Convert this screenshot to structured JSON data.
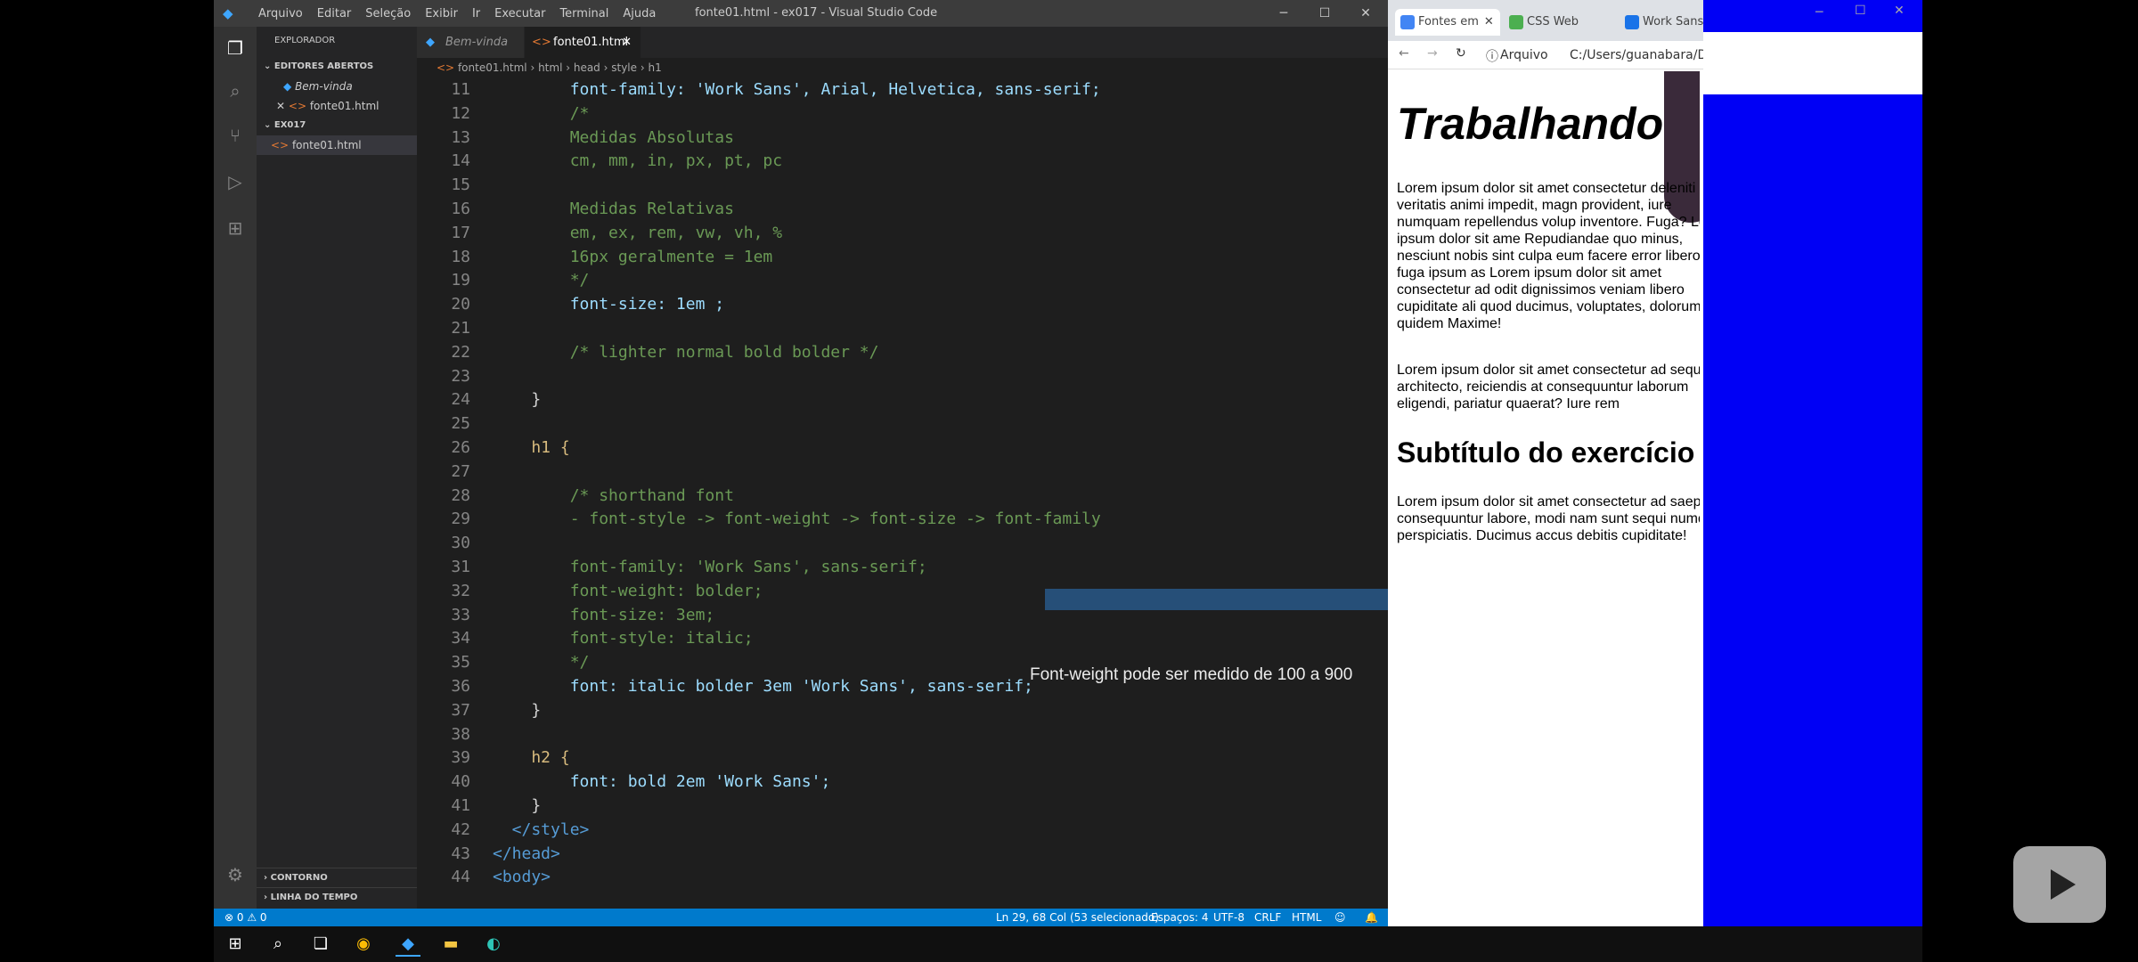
{
  "window": {
    "title": "fonte01.html - ex017 - Visual Studio Code",
    "menu": [
      "Arquivo",
      "Editar",
      "Seleção",
      "Exibir",
      "Ir",
      "Executar",
      "Terminal",
      "Ajuda"
    ]
  },
  "sidebar": {
    "title": "EXPLORADOR",
    "open_editors_header": "EDITORES ABERTOS",
    "open_editors": [
      "Bem-vinda",
      "fonte01.html"
    ],
    "folder_header": "EX017",
    "folder_files": [
      "fonte01.html"
    ],
    "outline": "CONTORNO",
    "timeline": "LINHA DO TEMPO"
  },
  "tabs": [
    "Bem-vinda",
    "fonte01.html"
  ],
  "breadcrumb": [
    "fonte01.html",
    "html",
    "head",
    "style",
    "h1"
  ],
  "code": {
    "lines": [
      {
        "n": "11",
        "text": "        font-family: 'Work Sans', Arial, Helvetica, sans-serif;"
      },
      {
        "n": "12",
        "text": "        /*"
      },
      {
        "n": "13",
        "text": "        Medidas Absolutas"
      },
      {
        "n": "14",
        "text": "        cm, mm, in, px, pt, pc"
      },
      {
        "n": "15",
        "text": ""
      },
      {
        "n": "16",
        "text": "        Medidas Relativas"
      },
      {
        "n": "17",
        "text": "        em, ex, rem, vw, vh, %"
      },
      {
        "n": "18",
        "text": "        16px geralmente = 1em"
      },
      {
        "n": "19",
        "text": "        */"
      },
      {
        "n": "20",
        "text": "        font-size: 1em ;"
      },
      {
        "n": "21",
        "text": ""
      },
      {
        "n": "22",
        "text": "        /* lighter normal bold bolder */"
      },
      {
        "n": "23",
        "text": ""
      },
      {
        "n": "24",
        "text": "    }"
      },
      {
        "n": "25",
        "text": ""
      },
      {
        "n": "26",
        "text": "    h1 {"
      },
      {
        "n": "27",
        "text": ""
      },
      {
        "n": "28",
        "text": "        /* shorthand font"
      },
      {
        "n": "29",
        "text": "        - font-style -> font-weight -> font-size -> font-family"
      },
      {
        "n": "30",
        "text": ""
      },
      {
        "n": "31",
        "text": "        font-family: 'Work Sans', sans-serif;"
      },
      {
        "n": "32",
        "text": "        font-weight: bolder;"
      },
      {
        "n": "33",
        "text": "        font-size: 3em;"
      },
      {
        "n": "34",
        "text": "        font-style: italic;"
      },
      {
        "n": "35",
        "text": "        */"
      },
      {
        "n": "36",
        "text": "        font: italic bolder 3em 'Work Sans', sans-serif;"
      },
      {
        "n": "37",
        "text": "    }"
      },
      {
        "n": "38",
        "text": ""
      },
      {
        "n": "39",
        "text": "    h2 {"
      },
      {
        "n": "40",
        "text": "        font: bold 2em 'Work Sans';"
      },
      {
        "n": "41",
        "text": "    }"
      },
      {
        "n": "42",
        "text": "  </style>"
      },
      {
        "n": "43",
        "text": "</head>"
      },
      {
        "n": "44",
        "text": "<body>"
      }
    ],
    "tooltip": "Font-weight pode ser medido de 100 a 900"
  },
  "status": {
    "problems": "⊗ 0 ⚠ 0",
    "position": "Ln 29, 68 Col (53 selecionado)",
    "spaces": "Espaços: 4",
    "encoding": "UTF-8",
    "eol": "CRLF",
    "language": "HTML"
  },
  "browser": {
    "tabs": [
      "Fontes em",
      "CSS Web",
      "Work Sans"
    ],
    "address_label": "Arquivo",
    "address": "C:/Users/guanabara/Do",
    "h1": "Trabalhando",
    "p1": "Lorem ipsum dolor sit amet consectetur deleniti rem, veritatis animi impedit, magn provident, iure numquam repellendus volup inventore. Fuga? Lorem ipsum dolor sit ame Repudiandae quo minus, nesciunt nobis sint culpa eum facere error libero, fuga ipsum as Lorem ipsum dolor sit amet consectetur ad odit dignissimos veniam libero cupiditate ali quod ducimus, voluptates, dolorum quidem Maxime!",
    "p2": "Lorem ipsum dolor sit amet consectetur ad sequi architecto, reiciendis at consequuntur laborum eligendi, pariatur quaerat? Iure rem",
    "h2": "Subtítulo do exercício",
    "p3": "Lorem ipsum dolor sit amet consectetur ad saepe consequuntur labore, modi nam sunt sequi numquam perspiciatis. Ducimus accus debitis cupiditate!"
  }
}
